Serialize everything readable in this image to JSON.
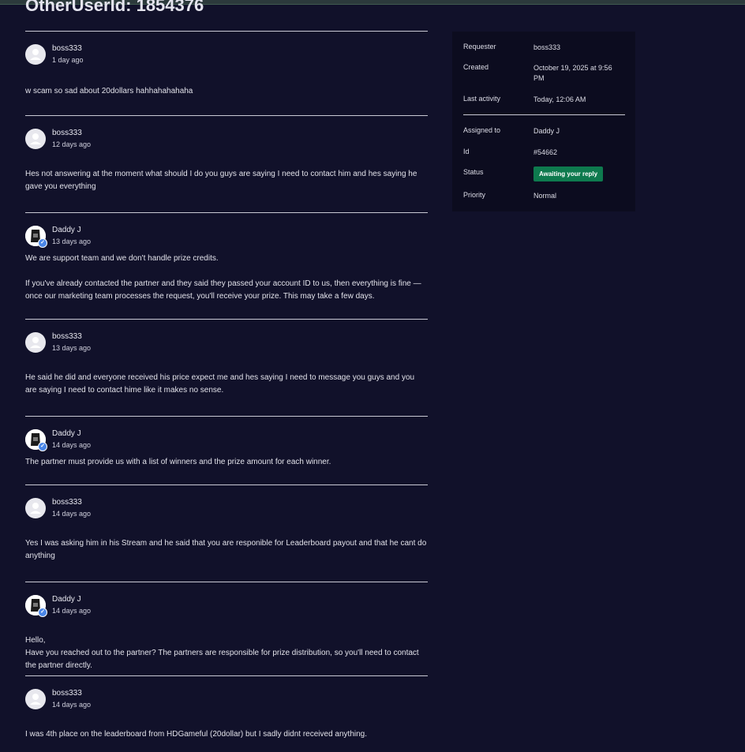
{
  "ticket": {
    "title": "OtherUserId: 1854376"
  },
  "comments": [
    {
      "author": "boss333",
      "time": "1 day ago",
      "body": [
        "w scam so sad about 20dollars hahhahahahaha"
      ]
    },
    {
      "author": "boss333",
      "time": "12 days ago",
      "body": [
        "Hes not answering at the moment what should I do you guys are saying I need to contact him and hes saying he gave you everything"
      ]
    },
    {
      "author": "Daddy J",
      "time": "13 days ago",
      "body": [
        "We are support team and we don't handle prize credits.",
        "If you've already contacted the partner and they said they passed your account ID to us, then everything is fine — once our marketing team processes the request, you'll receive your prize. This may take a few days."
      ]
    },
    {
      "author": "boss333",
      "time": "13 days ago",
      "body": [
        "He said he did and everyone received his price expect me and hes saying I need to message you guys and you are saying I need to contact hime like it makes no sense."
      ]
    },
    {
      "author": "Daddy J",
      "time": "14 days ago",
      "body": [
        "The partner must provide us with a list of winners and the prize amount for each winner."
      ]
    },
    {
      "author": "boss333",
      "time": "14 days ago",
      "body": [
        "Yes I was asking him in his Stream and he said that you are responible for Leaderboard payout and that he cant do anything"
      ]
    },
    {
      "author": "Daddy J",
      "time": "14 days ago",
      "body": [
        "Hello,\nHave you reached out to the partner? The partners are responsible for prize distribution, so you'll need to contact the partner directly."
      ]
    },
    {
      "author": "boss333",
      "time": "14 days ago",
      "body": [
        "I was 4th place on the leaderboard from HDGameful (20dollar) but I sadly didnt received anything."
      ]
    }
  ],
  "sidebar": {
    "requester": {
      "label": "Requester",
      "value": "boss333"
    },
    "created": {
      "label": "Created",
      "value": "October 19, 2025 at 9:56 PM"
    },
    "last_activity": {
      "label": "Last activity",
      "value": "Today, 12:06 AM"
    },
    "assigned_to": {
      "label": "Assigned to",
      "value": "Daddy J"
    },
    "id": {
      "label": "Id",
      "value": "#54662"
    },
    "status": {
      "label": "Status",
      "value": "Awaiting your reply"
    },
    "priority": {
      "label": "Priority",
      "value": "Normal"
    }
  },
  "colors": {
    "background": "#11112a",
    "sidebar": "#0c0c1f",
    "status_badge": "#0e7a4e",
    "agent_badge": "#4a86e8"
  }
}
